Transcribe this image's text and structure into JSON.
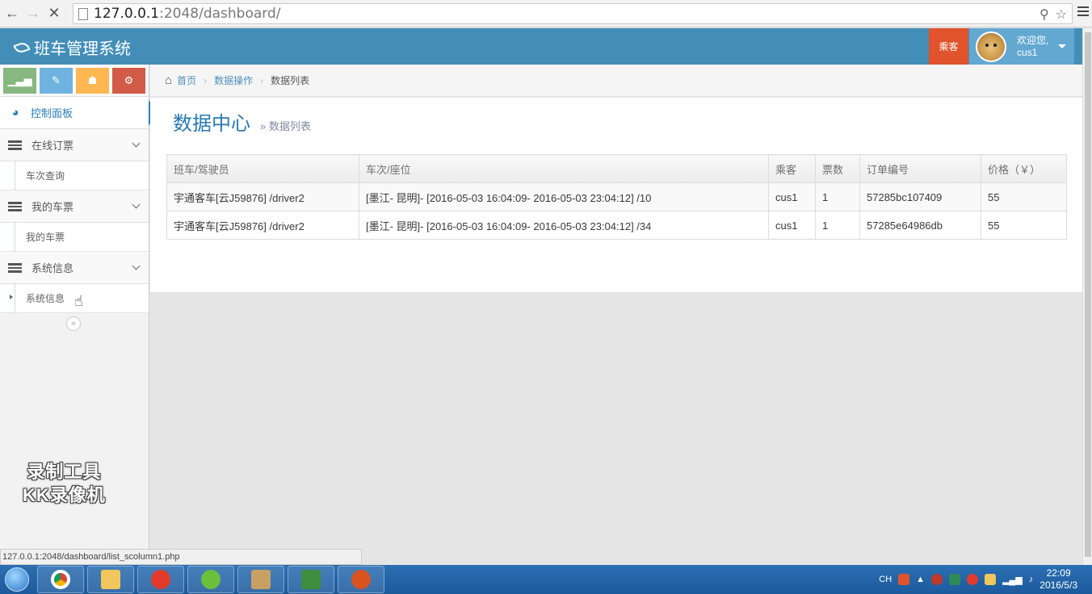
{
  "browser": {
    "url_host": "127.0.0.1",
    "url_path": ":2048/dashboard/",
    "status_url": "127.0.0.1:2048/dashboard/list_scolumn1.php"
  },
  "app": {
    "brand": "班车管理系统",
    "role_button": "乘客",
    "welcome": "欢迎您,",
    "username": "cus1"
  },
  "sidebar": {
    "control_panel": "控制面板",
    "groups": [
      {
        "label": "在线订票",
        "sub": "车次查询"
      },
      {
        "label": "我的车票",
        "sub": "我的车票"
      },
      {
        "label": "系统信息",
        "sub": "系统信息"
      }
    ],
    "collapse": "«",
    "watermark_line1": "录制工具",
    "watermark_line2": "KK录像机"
  },
  "breadcrumb": {
    "home": "首页",
    "data_ops": "数据操作",
    "current": "数据列表"
  },
  "page": {
    "title": "数据中心",
    "subtitle": "» 数据列表"
  },
  "table": {
    "headers": [
      "班车/驾驶员",
      "车次/座位",
      "乘客",
      "票数",
      "订单编号",
      "价格（￥）"
    ],
    "rows": [
      [
        "宇通客车[云J59876] /driver2",
        "[墨江- 昆明]- [2016-05-03 16:04:09- 2016-05-03 23:04:12] /10",
        "cus1",
        "1",
        "57285bc107409",
        "55"
      ],
      [
        "宇通客车[云J59876] /driver2",
        "[墨江- 昆明]- [2016-05-03 16:04:09- 2016-05-03 23:04:12] /34",
        "cus1",
        "1",
        "57285e64986db",
        "55"
      ]
    ]
  },
  "taskbar": {
    "lang": "CH",
    "time": "22:09",
    "date": "2016/5/3"
  }
}
